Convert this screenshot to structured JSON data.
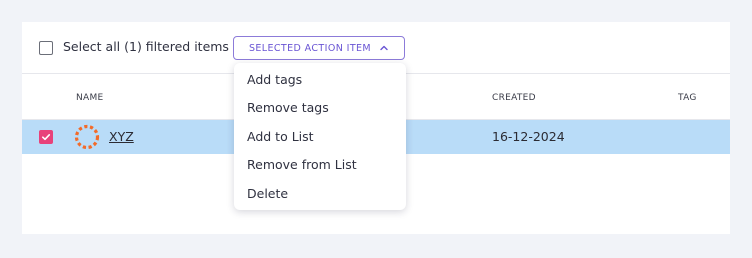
{
  "toolbar": {
    "select_all_label": "Select all (1) filtered items",
    "action_button_label": "SELECTED ACTION ITEM"
  },
  "table": {
    "columns": [
      "NAME",
      "CREATED",
      "TAG"
    ],
    "rows": [
      {
        "name": "XYZ",
        "created": "16-12-2024",
        "tag": "",
        "selected": true
      }
    ]
  },
  "action_menu": {
    "items": [
      "Add tags",
      "Remove tags",
      "Add to List",
      "Remove from List",
      "Delete"
    ]
  },
  "colors": {
    "accent": "#6a55d4",
    "selected_row": "#b9dcf8",
    "checkbox_checked": "#e8427a",
    "avatar": "#f26b2a"
  }
}
